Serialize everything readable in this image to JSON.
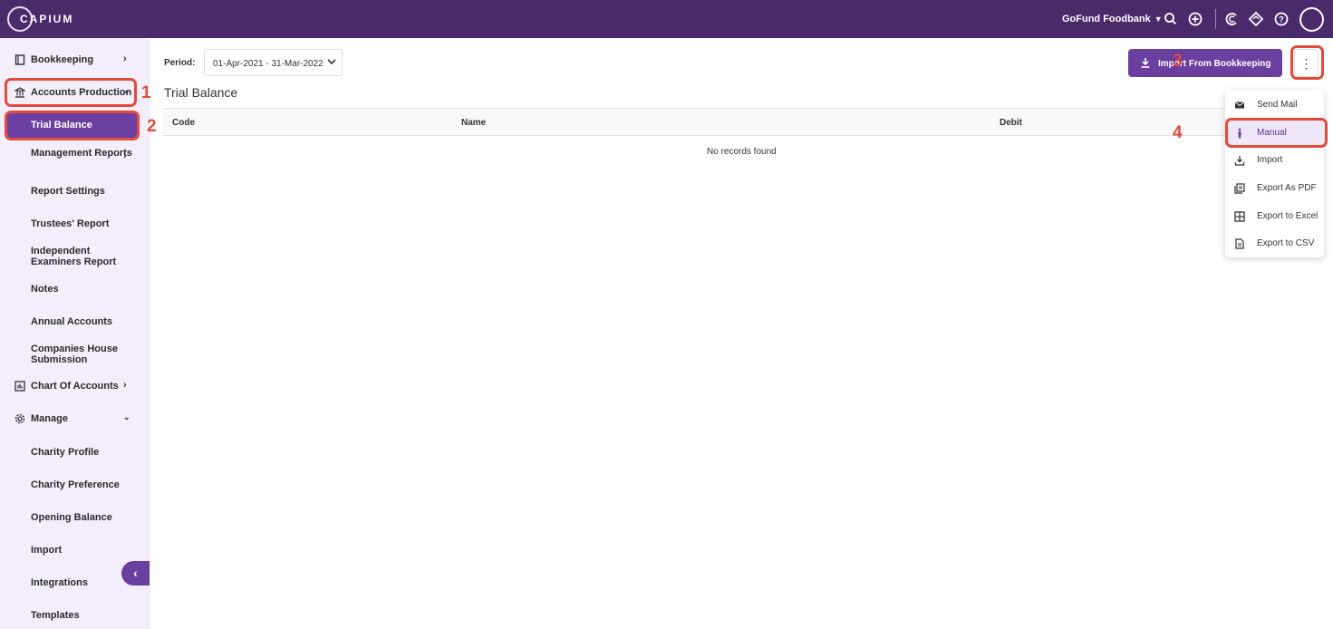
{
  "brand": {
    "logo_text": "CAPIUM"
  },
  "header": {
    "org_name": "GoFund Foodbank",
    "icons": [
      "search-icon",
      "add-circle-icon",
      "capium-icon",
      "diamond-icon",
      "help-icon",
      "avatar"
    ]
  },
  "sidebar": {
    "bookkeeping": "Bookkeeping",
    "accounts_production": "Accounts Production",
    "trial_balance": "Trial Balance",
    "management_reports": "Management Reports",
    "report_settings": "Report Settings",
    "trustees_report": "Trustees' Report",
    "independent_examiners": "Independent Examiners Report",
    "notes": "Notes",
    "annual_accounts": "Annual Accounts",
    "companies_house": "Companies House Submission",
    "chart_of_accounts": "Chart Of Accounts",
    "manage": "Manage",
    "charity_profile": "Charity Profile",
    "charity_preference": "Charity Preference",
    "opening_balance": "Opening Balance",
    "import": "Import",
    "integrations": "Integrations",
    "templates": "Templates"
  },
  "toolbar": {
    "period_label": "Period:",
    "period_value": "01-Apr-2021 - 31-Mar-2022",
    "import_label": "Import From Bookkeeping"
  },
  "page": {
    "title": "Trial Balance"
  },
  "table": {
    "columns": [
      "Code",
      "Name",
      "Debit"
    ],
    "empty_text": "No records found"
  },
  "menu": {
    "items": [
      "Send Mail",
      "Manual",
      "Import",
      "Export As PDF",
      "Export to Excel",
      "Export to CSV"
    ],
    "selected": "Manual"
  },
  "steps": [
    "1",
    "2",
    "3",
    "4"
  ],
  "colors": {
    "accent": "#6b3fa0",
    "topbar": "#4b2a6b",
    "callout": "#e04b3a",
    "sidebar_bg": "#f3eefa"
  }
}
